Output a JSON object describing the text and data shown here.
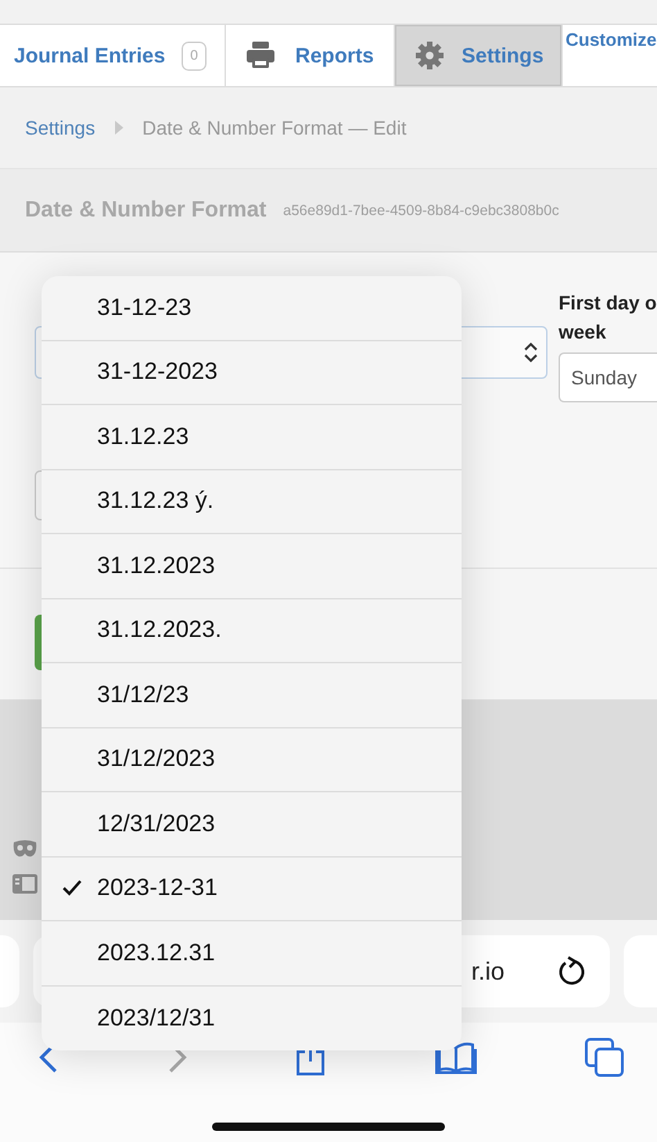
{
  "tabs": [
    {
      "label": "Journal Entries",
      "badge": "0",
      "selected": false
    },
    {
      "label": "Reports",
      "selected": false
    },
    {
      "label": "Settings",
      "selected": true
    },
    {
      "label": "Customize",
      "selected": false
    }
  ],
  "breadcrumb": {
    "parent": "Settings",
    "current": "Date & Number Format — Edit"
  },
  "heading": {
    "title": "Date & Number Format",
    "id_text": "a56e89d1-7bee-4509-8b84-c9ebc3808b0c"
  },
  "form": {
    "week_label_lines": [
      "First day o",
      "week"
    ],
    "week_value": "Sunday"
  },
  "dropdown": {
    "options": [
      {
        "label": "31-12-23",
        "selected": false
      },
      {
        "label": "31-12-2023",
        "selected": false
      },
      {
        "label": "31.12.23",
        "selected": false
      },
      {
        "label": "31.12.23 ý.",
        "selected": false
      },
      {
        "label": "31.12.2023",
        "selected": false
      },
      {
        "label": "31.12.2023.",
        "selected": false
      },
      {
        "label": "31/12/23",
        "selected": false
      },
      {
        "label": "31/12/2023",
        "selected": false
      },
      {
        "label": "12/31/2023",
        "selected": false
      },
      {
        "label": "2023-12-31",
        "selected": true
      },
      {
        "label": "2023.12.31",
        "selected": false
      },
      {
        "label": "2023/12/31",
        "selected": false
      }
    ]
  },
  "browser": {
    "url_text": "r.io"
  }
}
